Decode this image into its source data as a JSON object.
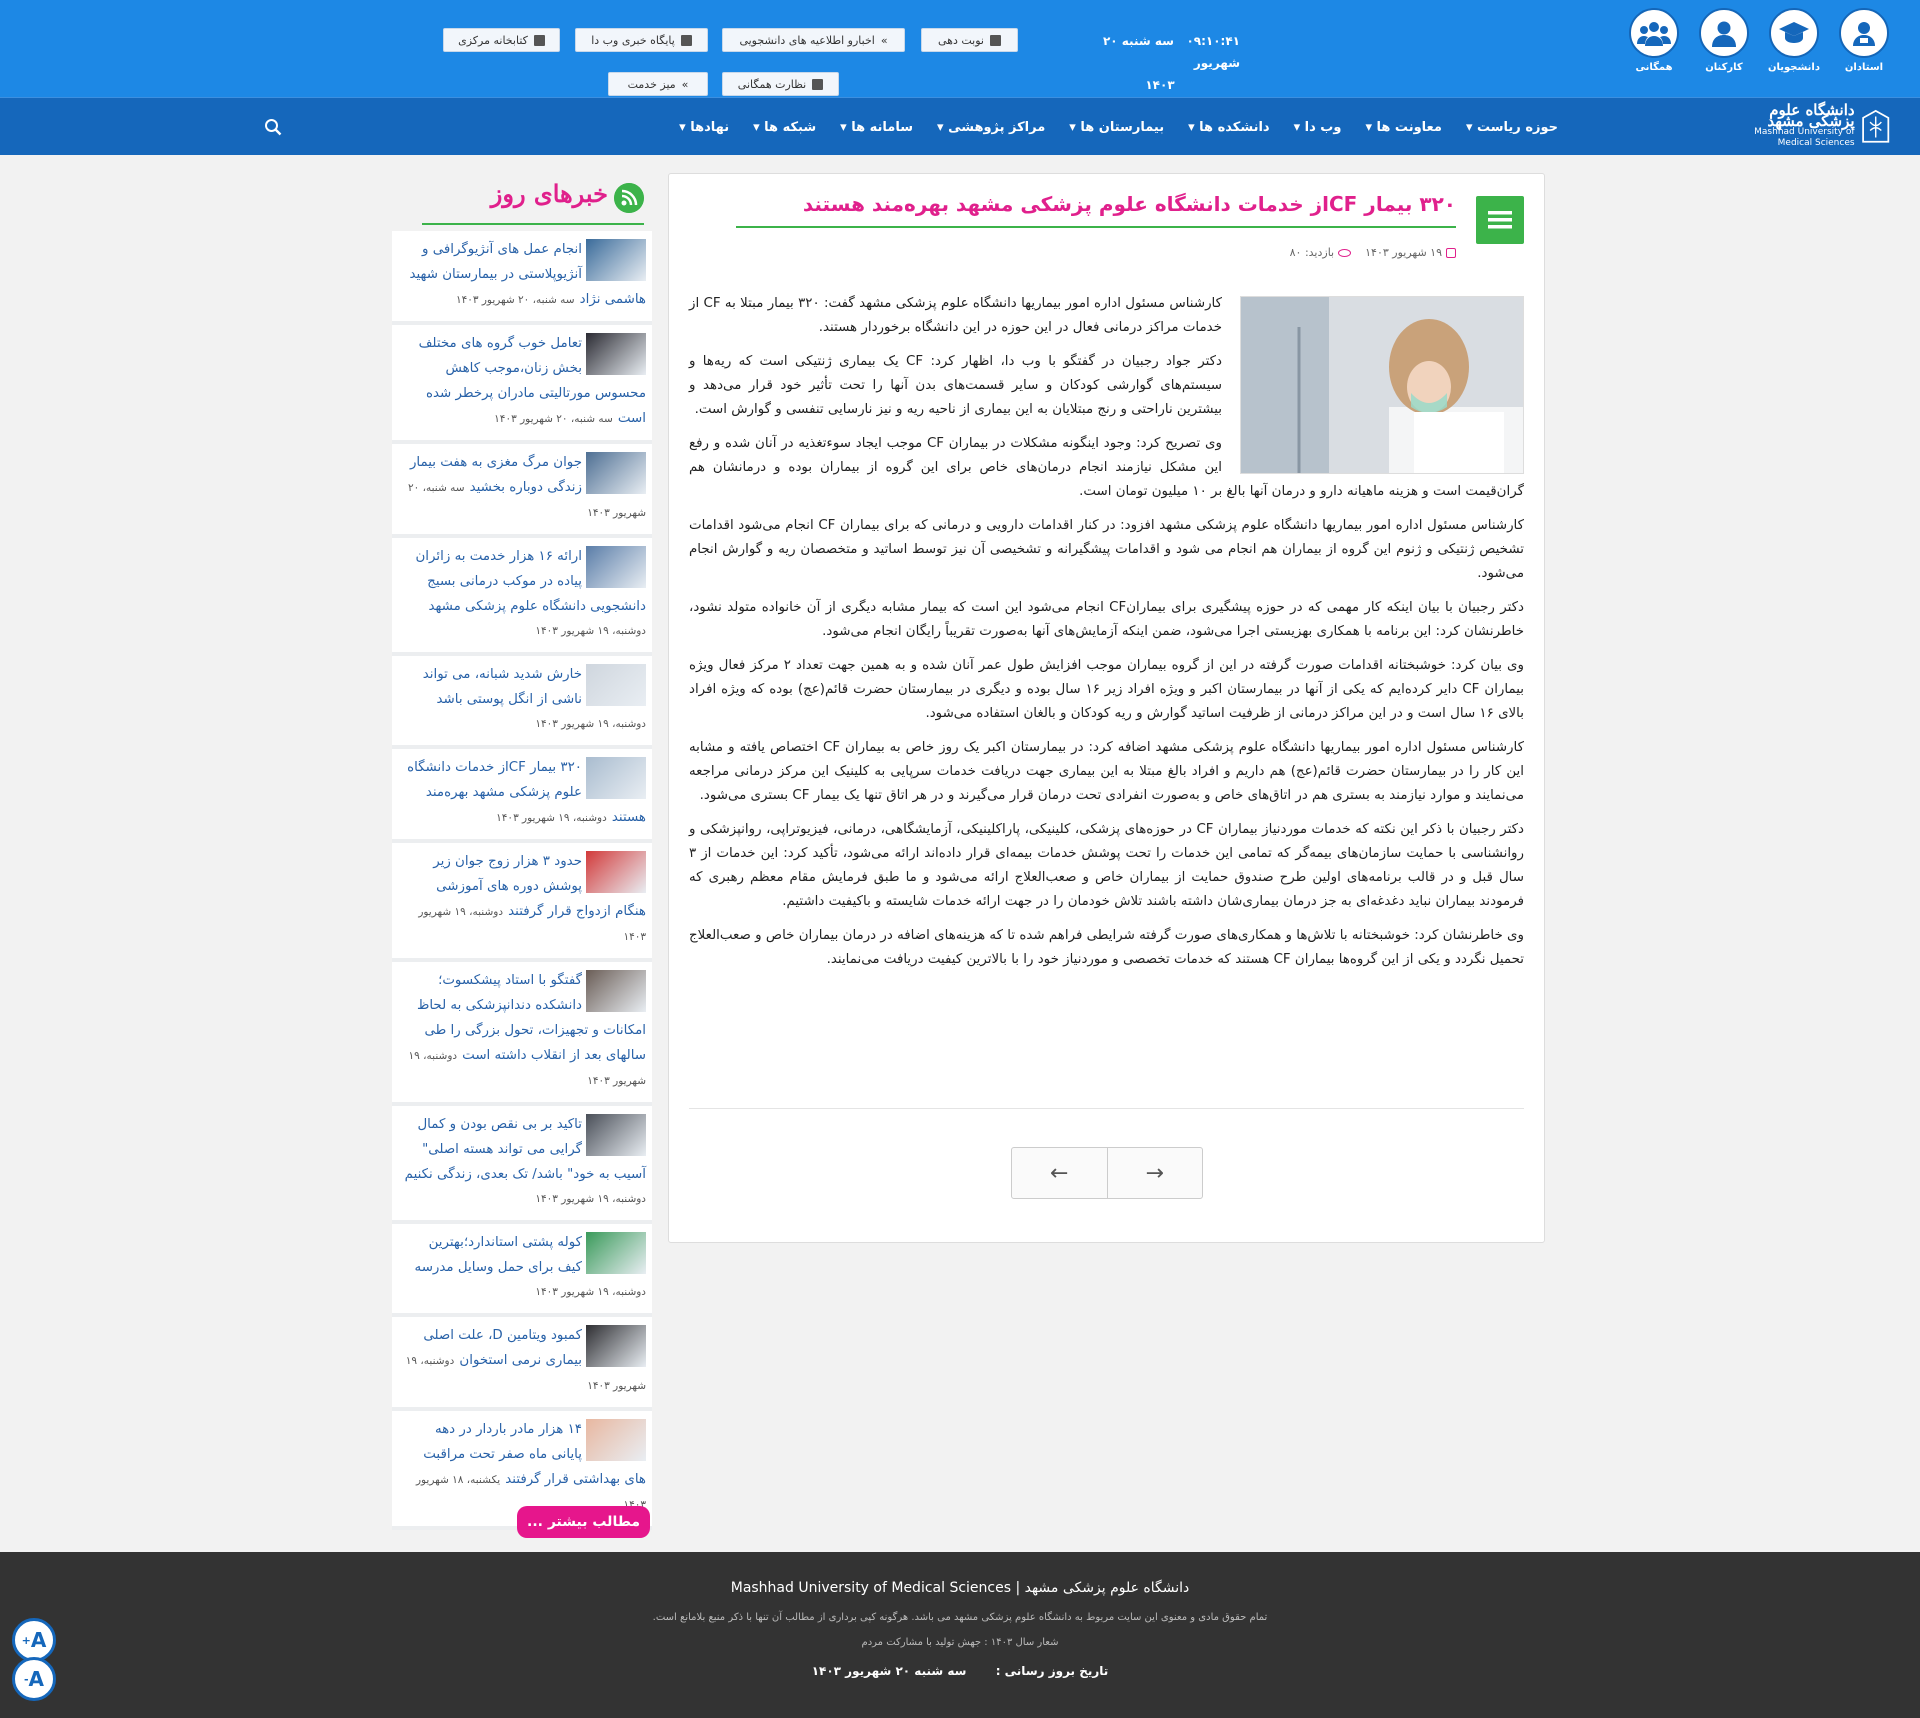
{
  "topbar": {
    "icons": [
      {
        "label": "استادان",
        "icon": "professor-icon"
      },
      {
        "label": "دانشجویان",
        "icon": "graduation-cap-icon"
      },
      {
        "label": "کارکنان",
        "icon": "user-icon"
      },
      {
        "label": "همگانی",
        "icon": "users-group-icon"
      }
    ],
    "time": "۰۹:۱۰:۴۱",
    "date": "سه شنبه ۲۰ شهریور",
    "year": "۱۴۰۳",
    "buttons": {
      "nobat": "نوبت دهی",
      "akhbar": "اخبارو اطلاعیه های دانشجویی",
      "paygah": "پایگاه خبری وب دا",
      "ketabkhane": "کتابخانه مرکزی",
      "nezarat": "نظارت همگانی",
      "miz": "میز خدمت"
    },
    "colors": {
      "bar": "#1d88e5",
      "nav": "#1567bb"
    }
  },
  "nav": {
    "logo_fa": "دانشگاه علوم پزشکی مشهد",
    "logo_en1": "Mashhad University of",
    "logo_en2": "Medical Sciences",
    "items": [
      "حوزه ریاست",
      "معاونت ها",
      "وب دا",
      "دانشکده ها",
      "بیمارستان ها",
      "مراکز پژوهشی",
      "سامانه ها",
      "شبکه ها",
      "نهادها"
    ]
  },
  "article": {
    "title": "۳۲۰ بیمار CFاز خدمات دانشگاه علوم پزشکی مشهد بهره‌مند هستند",
    "date": "۱۹ شهریور ۱۴۰۳",
    "views": "بازدید: ۸۰",
    "paragraphs": [
      "کارشناس مسئول اداره امور بیماریها دانشگاه علوم پزشکی مشهد گفت: ۳۲۰ بیمار مبتلا به CF از خدمات مراکز درمانی فعال در این حوزه در این دانشگاه برخوردار هستند.",
      "دکتر جواد رجبیان در گفتگو با وب دا، اظهار کرد: CF  یک بیماری ژنتیکی است که ریه‌ها و سیستم‌های گوارشی کودکان و سایر قسمت‌های بدن آنها را تحت تأثیر خود قرار می‌دهد و بیشترین ناراحتی و رنج مبتلایان به این بیماری از ناحیه ریه و نیز نارسایی تنفسی و گوارش است.",
      "وی تصریح کرد: وجود اینگونه مشکلات در بیماران CF موجب ایجاد سوءتغذیه در آنان شده و رفع این مشکل نیازمند انجام درمان‌های خاص برای این گروه از بیماران بوده و درمانشان هم گران‌قیمت است و هزینه ماهیانه دارو و درمان آنها بالغ بر ۱۰ میلیون تومان است.",
      "کارشناس مسئول اداره امور بیماریها دانشگاه علوم پزشکی مشهد افزود: در کنار اقدامات دارویی و درمانی که برای بیماران CF انجام می‌شود اقدامات تشخیص ژنتیکی و ژنوم این گروه از بیماران هم انجام می شود و اقدامات پیشگیرانه و تشخیصی آن نیز توسط اساتید و متخصصان ریه و گوارش انجام می‌شود.",
      "دکتر رجبیان با بیان اینکه کار مهمی که در حوزه پیشگیری برای بیمارانCF انجام می‌شود این است که بیمار مشابه دیگری از آن خانواده متولد نشود، خاطرنشان کرد: این برنامه با همکاری بهزیستی اجرا می‌شود، ضمن اینکه آزمایش‌های آنها به‌صورت تقریباً رایگان انجام می‌شود.",
      "وی بیان کرد: خوشبختانه اقدامات صورت گرفته در این از گروه بیماران موجب افزایش طول عمر آنان شده و به همین جهت تعداد ۲ مرکز فعال ویژه بیماران CF دایر کرده‌ایم که یکی از آنها در بیمارستان اکبر و ویژه افراد زیر ۱۶ سال بوده و دیگری در بیمارستان حضرت قائم(عج) بوده که ویژه افراد بالای ۱۶ سال است و در این مراکز درمانی از ظرفیت اساتید گوارش و ریه کودکان و بالغان استفاده می‌شود.",
      "کارشناس مسئول اداره امور بیماریها دانشگاه علوم پزشکی مشهد اضافه کرد: در بیمارستان اکبر یک روز خاص به بیماران CF اختصاص یافته و مشابه این کار را در بیمارستان حضرت قائم(عج) هم داریم و افراد بالغ مبتلا به این بیماری جهت دریافت خدمات سرپایی به کلینیک این مرکز درمانی مراجعه می‌نمایند و موارد نیازمند به بستری هم در اتاق‌های خاص و به‌صورت انفرادی تحت درمان قرار می‌گیرند و در هر اتاق تنها یک بیمار CF بستری می‌شود.",
      "دکتر رجبیان با ذکر این نکته که خدمات موردنیاز بیماران CF در حوزه‌های پزشکی، کلینیکی، پاراکلینیکی، آزمایشگاهی، درمانی، فیزیوتراپی، روانپزشکی و روانشناسی با حمایت سازمان‌های بیمه‌گر که تمامی این خدمات را تحت پوشش خدمات بیمه‌ای قرار داده‌اند ارائه می‌شود، تأکید کرد: این خدمات از ۳ سال قبل و در قالب برنامه‌های اولین طرح صندوق حمایت از بیماران خاص و صعب‌العلاج ارائه می‌شود و ما طبق فرمایش مقام معظم رهبری که فرمودند بیماران نباید دغدغه‌ای به جز درمان بیماری‌شان داشته باشند تلاش خودمان را در جهت ارائه خدمات شایسته و باکیفیت داشتیم.",
      "وی خاطرنشان کرد: خوشبختانه با تلاش‌ها و همکاری‌های صورت گرفته شرایطی فراهم شده تا که هزینه‌های اضافه در درمان بیماران خاص و صعب‌العلاج تحمیل نگردد و یکی از این گروه‌ها بیماران CF هستند که خدمات تخصصی و موردنیاز خود را با بالاترین کیفیت دریافت می‌نمایند."
    ]
  },
  "sidebar": {
    "title": "خبرهای روز",
    "more": "مطالب بیشتر ...",
    "news": [
      {
        "title": "انجام عمل های آنژیوگرافی و آنژیوپلاستی در بیمارستان شهید هاشمی نژاد",
        "date": "سه شنبه، ۲۰ شهریور ۱۴۰۳",
        "color": "#3a6b9a"
      },
      {
        "title": "تعامل خوب گروه های مختلف بخش زنان،موجب کاهش محسوس مورتالیتی مادران پرخطر شده است",
        "date": "سه شنبه، ۲۰ شهریور ۱۴۰۳",
        "color": "#2b2b33"
      },
      {
        "title": "جوان مرگ مغزی به هفت بیمار زندگی دوباره بخشید",
        "date": "سه شنبه، ۲۰ شهریور ۱۴۰۳",
        "color": "#4e6f93"
      },
      {
        "title": "ارائه ۱۶ هزار خدمت به زائران پیاده در موکب درمانی بسیج دانشجویی دانشگاه علوم پزشکی مشهد",
        "date": "دوشنبه، ۱۹ شهریور ۱۴۰۳",
        "color": "#5a7da8"
      },
      {
        "title": "خارش شدید شبانه، می تواند ناشی از انگل پوستی باشد",
        "date": "دوشنبه، ۱۹ شهریور ۱۴۰۳",
        "color": "#cfd6de"
      },
      {
        "title": "۳۲۰ بیمار CFاز خدمات دانشگاه علوم پزشکی مشهد بهره‌مند هستند",
        "date": "دوشنبه، ۱۹ شهریور ۱۴۰۳",
        "color": "#a9bccf"
      },
      {
        "title": "حدود ۳ هزار زوج جوان زیر پوشش دوره های آموزشی هنگام ازدواج قرار گرفتند",
        "date": "دوشنبه، ۱۹ شهریور ۱۴۰۳",
        "color": "#d23a3a"
      },
      {
        "title": "گفتگو با استاد پیشکسوت؛ دانشکده دندانپزشکی به لحاظ امکانات و تجهیزات، تحول بزرگی را طی سالهای بعد از انقلاب داشته است",
        "date": "دوشنبه، ۱۹ شهریور ۱۴۰۳",
        "color": "#6a5d56"
      },
      {
        "title": "تاکید بر بی نقص بودن و کمال گرایی می تواند هسته اصلی\" آسیب به خود\" باشد/ تک بعدی، زندگی نکنیم",
        "date": "دوشنبه، ۱۹ شهریور ۱۴۰۳",
        "color": "#4a4f58"
      },
      {
        "title": "کوله پشتی استاندارد؛بهترین کیف برای حمل وسایل مدرسه",
        "date": "دوشنبه، ۱۹ شهریور ۱۴۰۳",
        "color": "#3a9a5a"
      },
      {
        "title": "کمبود ویتامین D، علت اصلی بیماری نرمی استخوان",
        "date": "دوشنبه، ۱۹ شهریور ۱۴۰۳",
        "color": "#2e2e32"
      },
      {
        "title": "۱۴ هزار مادر باردار در دهه پایانی ماه صفر تحت مراقبت های بهداشتی قرار گرفتند",
        "date": "یکشنبه، ۱۸ شهریور ۱۴۰۳",
        "color": "#e8b7a0"
      }
    ]
  },
  "footer": {
    "line1": "دانشگاه علوم پزشکی مشهد | Mashhad University of Medical Sciences",
    "line2": "تمام حقوق مادی و معنوی این سایت مربوط به دانشگاه علوم پزشکی مشهد می باشد. هرگونه کپی برداری از مطالب آن تنها با ذکر منبع بلامانع است.",
    "line3": "شعار سال ۱۴۰۳ : جهش تولید با مشارکت مردم",
    "update_label": "تاریخ بروز رسانی :",
    "update_value": "سه شنبه ۲۰ شهریور ۱۴۰۳"
  }
}
